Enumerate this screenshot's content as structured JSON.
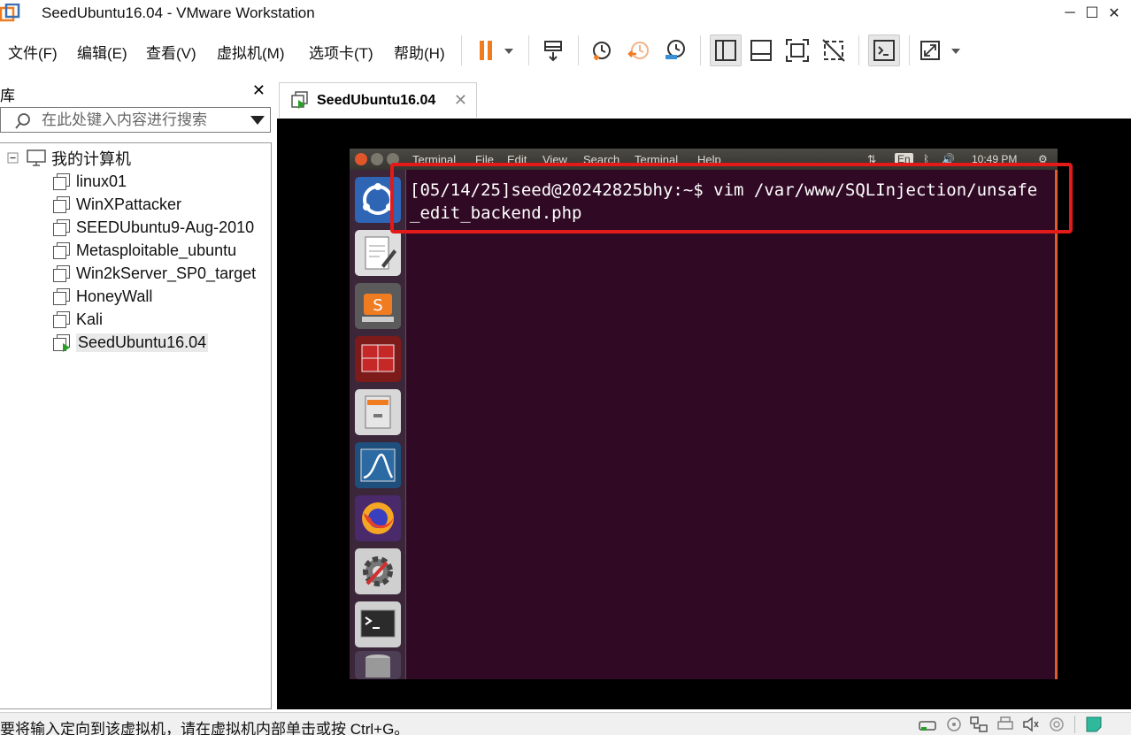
{
  "window": {
    "title": "SeedUbuntu16.04 - VMware Workstation",
    "minimize_glyph": "─",
    "maximize_glyph": "☐",
    "close_glyph": "✕"
  },
  "menu": {
    "items": [
      {
        "label": "文件(F)"
      },
      {
        "label": "编辑(E)"
      },
      {
        "label": "查看(V)"
      },
      {
        "label": "虚拟机(M)"
      },
      {
        "label": "选项卡(T)"
      },
      {
        "label": "帮助(H)"
      }
    ]
  },
  "toolbar": {
    "accent": "#f07c22",
    "icons": [
      "pause-icon",
      "send-keys-icon",
      "snapshot-icon",
      "revert-snapshot-icon",
      "snapshot-manager-icon",
      "library-view-icon",
      "thumbnail-bar-icon",
      "fullscreen-icon",
      "unity-icon",
      "console-view-icon",
      "stretch-icon"
    ]
  },
  "library": {
    "title": "库",
    "close_glyph": "✕",
    "search_placeholder": "在此处键入内容进行搜索",
    "root": "我的计算机",
    "vms": [
      {
        "name": "linux01",
        "running": false
      },
      {
        "name": "WinXPattacker",
        "running": false
      },
      {
        "name": "SEEDUbuntu9-Aug-2010",
        "running": false
      },
      {
        "name": "Metasploitable_ubuntu",
        "running": false
      },
      {
        "name": "Win2kServer_SP0_target",
        "running": false
      },
      {
        "name": "HoneyWall",
        "running": false
      },
      {
        "name": "Kali",
        "running": false
      },
      {
        "name": "SeedUbuntu16.04",
        "running": true
      }
    ]
  },
  "tab": {
    "label": "SeedUbuntu16.04",
    "close_glyph": "✕"
  },
  "guest": {
    "topbar_menus": [
      "Terminal",
      "File",
      "Edit",
      "View",
      "Search",
      "Terminal",
      "Help"
    ],
    "tray": {
      "keyboard": "En",
      "clock": "10:49 PM"
    },
    "terminal_line": "[05/14/25]seed@20242825bhy:~$ vim /var/www/SQLInjection/unsafe_edit_backend.php",
    "background": "#300a24",
    "annotation_color": "#e21a1a"
  },
  "statusbar": {
    "message": "要将输入定向到该虚拟机，请在虚拟机内部单击或按 Ctrl+G。"
  }
}
